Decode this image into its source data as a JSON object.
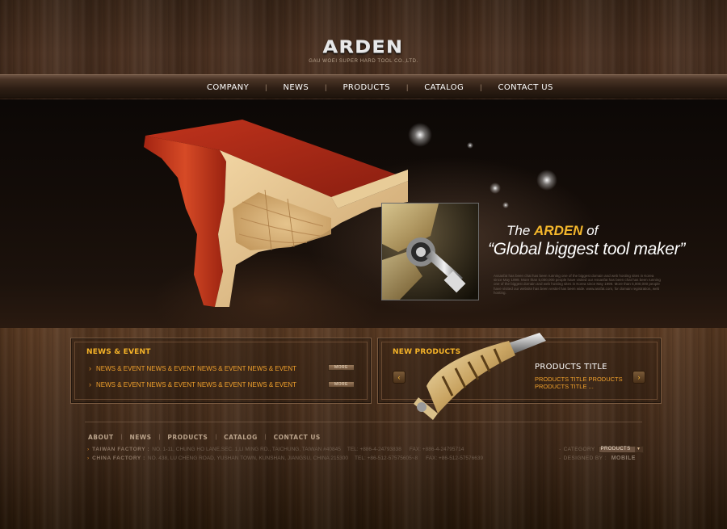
{
  "header": {
    "logo": "ARDEN",
    "company_name": "GAU WOEI SUPER HARD TOOL CO.,LTD."
  },
  "nav": {
    "items": [
      "COMPANY",
      "NEWS",
      "PRODUCTS",
      "CATALOG",
      "CONTACT US"
    ]
  },
  "hero": {
    "headline_the": "The",
    "headline_brand": "ARDEN",
    "headline_of": "of",
    "headline_tagline": "“Global biggest tool maker”",
    "paragraph": "Assasfat has been chat has been running one of the biggest domain and web hosting sites in Korea since May 1999. More than 5,000,000 people have visited our Assasfat has been chat has been running one of the biggest domain and web hosting sites in Korea since May 1999. More than 5,000,000 people have visited our website has been vestiel has been wide. www.assfat.com, for domain registration, web hosting."
  },
  "news": {
    "title": "NEWS & EVENT",
    "items": [
      "NEWS & EVENT NEWS & EVENT NEWS & EVENT NEWS & EVENT",
      "NEWS & EVENT NEWS & EVENT NEWS & EVENT NEWS & EVENT"
    ],
    "more_label": "MORE"
  },
  "new_products": {
    "title": "NEW PRODUCTS",
    "product_title": "PRODUCTS TITLE",
    "product_desc": "PRODUCTS TITLE PRODUCTS PRODUCTS TITLE ...",
    "prev_icon": "‹",
    "next_icon": "›"
  },
  "footer": {
    "nav": [
      "ABOUT",
      "NEWS",
      "PRODUCTS",
      "CATALOG",
      "CONTACT US"
    ],
    "taiwan": {
      "label": "TAIWAN FACTORY :",
      "address": "NO. 1-11, CHUNG HO LANE,SEC. 1,LI MING RD., TAICHUNG, TAIWAN #40845",
      "tel": "TEL: +886-4-24793838",
      "fax": "FAX: +886-4-24795714"
    },
    "china": {
      "label": "CHINA FACTORY :",
      "address": "NO. 438, LU CHENG ROAD, YUSHAN TOWN, KUNSHAN, JIANGSU, CHINA 215300",
      "tel": "TEL: +86-512-57575605~8",
      "fax": "FAX: +86-512-57576639"
    },
    "category_label": "CATEGORY",
    "category_value": "PRODUCTS",
    "designed_by_label": "DESIGNED BY :",
    "designer": "MOBILE"
  },
  "colors": {
    "accent": "#f4b72c",
    "link": "#f1a12c"
  }
}
